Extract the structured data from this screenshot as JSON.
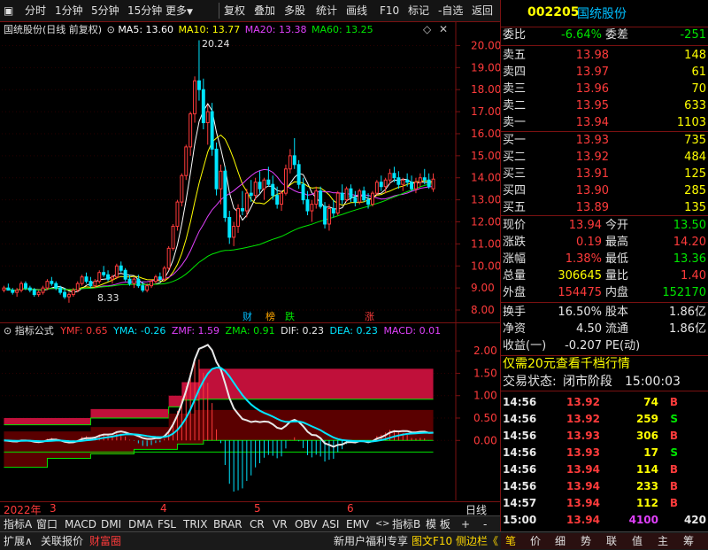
{
  "toolbar": {
    "timeframes": [
      "分时",
      "1分钟",
      "5分钟",
      "15分钟",
      "更多"
    ],
    "buttons": [
      "复权",
      "叠加",
      "多股",
      "统计",
      "画线",
      "F10",
      "标记",
      "-自选",
      "返回"
    ]
  },
  "stock": {
    "code": "002205",
    "name": "国统股份"
  },
  "chart_title": {
    "name": "国统股份(日线 前复权)",
    "ma": [
      {
        "label": "MA5: 13.60",
        "color": "#ffffff"
      },
      {
        "label": "MA10: 13.77",
        "color": "#ffff00"
      },
      {
        "label": "MA20: 13.38",
        "color": "#e040fb"
      },
      {
        "label": "MA60: 13.25",
        "color": "#00e600"
      }
    ]
  },
  "annotations": {
    "high": "20.24",
    "low": "8.33"
  },
  "event_marks": [
    {
      "label": "财",
      "color": "#00bfff"
    },
    {
      "label": "榜",
      "color": "#ffa500"
    },
    {
      "label": "跌",
      "color": "#00e600"
    },
    {
      "label": "涨",
      "color": "#ff3b3b"
    }
  ],
  "indicator": {
    "name": "指标公式",
    "values": [
      {
        "label": "YMF: 0.65",
        "color": "#ff3b3b"
      },
      {
        "label": "YMA: -0.26",
        "color": "#00e5ff"
      },
      {
        "label": "ZMF: 1.59",
        "color": "#e040fb"
      },
      {
        "label": "ZMA: 0.91",
        "color": "#00e600"
      },
      {
        "label": "DIF: 0.23",
        "color": "#e8e8e8"
      },
      {
        "label": "DEA: 0.23",
        "color": "#00e5ff"
      },
      {
        "label": "MACD: 0.01",
        "color": "#e040fb"
      }
    ]
  },
  "x_axis": {
    "year": "2022年",
    "months": [
      "3",
      "4",
      "5",
      "6"
    ],
    "period": "日线"
  },
  "bottom_tabs": [
    "指标A",
    "窗口",
    "MACD",
    "DMI",
    "DMA",
    "FSL",
    "TRIX",
    "BRAR",
    "CR",
    "VR",
    "OBV",
    "ASI",
    "EMV"
  ],
  "bottom_tabs_right": [
    "指标B",
    "模 板",
    "+",
    "-"
  ],
  "status_bar": {
    "left": [
      "扩展∧",
      "关联报价",
      "财富圈"
    ],
    "right": [
      "新用户福利专享",
      "图文F10",
      "侧边栏《"
    ],
    "right_icons": [
      "笔",
      "价",
      "细",
      "势",
      "联",
      "值",
      "主",
      "筹"
    ]
  },
  "quote": {
    "weibi_label": "委比",
    "weibi": "-6.64%",
    "weicha_label": "委差",
    "weicha": "-251",
    "asks": [
      {
        "label": "卖五",
        "price": "13.98",
        "vol": "148"
      },
      {
        "label": "卖四",
        "price": "13.97",
        "vol": "61"
      },
      {
        "label": "卖三",
        "price": "13.96",
        "vol": "70"
      },
      {
        "label": "卖二",
        "price": "13.95",
        "vol": "633"
      },
      {
        "label": "卖一",
        "price": "13.94",
        "vol": "1103"
      }
    ],
    "bids": [
      {
        "label": "买一",
        "price": "13.93",
        "vol": "735"
      },
      {
        "label": "买二",
        "price": "13.92",
        "vol": "484"
      },
      {
        "label": "买三",
        "price": "13.91",
        "vol": "125"
      },
      {
        "label": "买四",
        "price": "13.90",
        "vol": "285"
      },
      {
        "label": "买五",
        "price": "13.89",
        "vol": "135"
      }
    ],
    "stats": [
      {
        "l1": "现价",
        "v1": "13.94",
        "c1": "red",
        "l2": "今开",
        "v2": "13.50",
        "c2": "green"
      },
      {
        "l1": "涨跌",
        "v1": "0.19",
        "c1": "red",
        "l2": "最高",
        "v2": "14.20",
        "c2": "red"
      },
      {
        "l1": "涨幅",
        "v1": "1.38%",
        "c1": "red",
        "l2": "最低",
        "v2": "13.36",
        "c2": "green"
      },
      {
        "l1": "总量",
        "v1": "306645",
        "c1": "yellow",
        "l2": "量比",
        "v2": "1.40",
        "c2": "red"
      },
      {
        "l1": "外盘",
        "v1": "154475",
        "c1": "red",
        "l2": "内盘",
        "v2": "152170",
        "c2": "green"
      }
    ],
    "stats2": [
      {
        "l1": "换手",
        "v1": "16.50%",
        "l2": "股本",
        "v2": "1.86亿"
      },
      {
        "l1": "净资",
        "v1": "4.50",
        "l2": "流通",
        "v2": "1.86亿"
      },
      {
        "l1": "收益(一)",
        "v1": "-0.207",
        "l2": "PE(动)",
        "v2": ""
      }
    ],
    "promo": "仅需20元查看千档行情",
    "trade_status_label": "交易状态:",
    "trade_status": "闭市阶段",
    "trade_time": "15:00:03"
  },
  "ticks": [
    {
      "time": "14:56",
      "price": "13.92",
      "vol": "74",
      "bs": "B"
    },
    {
      "time": "14:56",
      "price": "13.92",
      "vol": "259",
      "bs": "S"
    },
    {
      "time": "14:56",
      "price": "13.93",
      "vol": "306",
      "bs": "B"
    },
    {
      "time": "14:56",
      "price": "13.93",
      "vol": "17",
      "bs": "S"
    },
    {
      "time": "14:56",
      "price": "13.94",
      "vol": "114",
      "bs": "B"
    },
    {
      "time": "14:56",
      "price": "13.94",
      "vol": "233",
      "bs": "B"
    },
    {
      "time": "14:57",
      "price": "13.94",
      "vol": "112",
      "bs": "B"
    },
    {
      "time": "15:00",
      "price": "13.94",
      "vol": "4100",
      "bs": "420"
    }
  ],
  "chart_data": [
    {
      "type": "candlestick",
      "title": "国统股份(日线 前复权)",
      "y_ticks": [
        "20.00",
        "19.00",
        "18.00",
        "17.00",
        "16.00",
        "15.00",
        "14.00",
        "13.00",
        "12.00",
        "11.00",
        "10.00",
        "9.00",
        "8.00"
      ],
      "ylim": [
        7.8,
        20.5
      ],
      "candles": [
        [
          8.9,
          9.1,
          8.8,
          9.0
        ],
        [
          9.0,
          9.2,
          8.9,
          8.9
        ],
        [
          8.9,
          9.0,
          8.7,
          8.8
        ],
        [
          8.8,
          9.0,
          8.6,
          8.9
        ],
        [
          8.9,
          9.3,
          8.8,
          9.2
        ],
        [
          9.2,
          9.3,
          8.9,
          9.0
        ],
        [
          9.0,
          9.1,
          8.8,
          8.9
        ],
        [
          8.9,
          9.0,
          8.6,
          8.7
        ],
        [
          8.7,
          8.9,
          8.6,
          8.8
        ],
        [
          8.8,
          9.1,
          8.7,
          9.0
        ],
        [
          9.0,
          9.4,
          8.9,
          9.3
        ],
        [
          9.3,
          9.5,
          9.1,
          9.2
        ],
        [
          9.2,
          9.3,
          8.9,
          9.0
        ],
        [
          9.0,
          9.1,
          8.7,
          8.8
        ],
        [
          8.8,
          9.0,
          8.5,
          8.6
        ],
        [
          8.6,
          8.8,
          8.33,
          8.7
        ],
        [
          8.7,
          9.0,
          8.6,
          8.9
        ],
        [
          8.9,
          9.3,
          8.8,
          9.2
        ],
        [
          9.2,
          9.6,
          9.1,
          9.5
        ],
        [
          9.5,
          9.7,
          9.2,
          9.3
        ],
        [
          9.3,
          9.5,
          9.0,
          9.1
        ],
        [
          9.1,
          9.4,
          9.0,
          9.3
        ],
        [
          9.3,
          9.8,
          9.2,
          9.7
        ],
        [
          9.7,
          10.0,
          9.5,
          9.6
        ],
        [
          9.6,
          9.8,
          9.3,
          9.4
        ],
        [
          9.4,
          9.6,
          9.2,
          9.5
        ],
        [
          9.5,
          10.1,
          9.4,
          10.0
        ],
        [
          10.0,
          10.2,
          9.7,
          9.8
        ],
        [
          9.8,
          9.9,
          9.3,
          9.4
        ],
        [
          9.4,
          9.6,
          9.1,
          9.2
        ],
        [
          9.2,
          9.5,
          9.0,
          9.4
        ],
        [
          9.4,
          9.6,
          9.0,
          9.1
        ],
        [
          9.1,
          9.3,
          8.8,
          8.9
        ],
        [
          8.9,
          9.2,
          8.8,
          9.1
        ],
        [
          9.1,
          9.4,
          9.0,
          9.3
        ],
        [
          9.3,
          9.6,
          9.2,
          9.5
        ],
        [
          9.5,
          9.7,
          9.3,
          9.4
        ],
        [
          9.4,
          10.0,
          9.3,
          9.9
        ],
        [
          9.9,
          10.9,
          9.8,
          10.8
        ],
        [
          10.8,
          11.9,
          10.7,
          11.8
        ],
        [
          11.8,
          13.0,
          11.6,
          12.9
        ],
        [
          12.9,
          14.2,
          12.7,
          14.1
        ],
        [
          14.1,
          15.5,
          13.9,
          15.4
        ],
        [
          15.4,
          17.0,
          15.0,
          16.9
        ],
        [
          16.9,
          18.6,
          16.5,
          18.4
        ],
        [
          18.4,
          20.24,
          17.5,
          18.0
        ],
        [
          18.0,
          18.5,
          16.2,
          16.5
        ],
        [
          16.5,
          17.3,
          15.5,
          17.0
        ],
        [
          17.0,
          17.4,
          15.0,
          15.3
        ],
        [
          15.3,
          15.6,
          13.2,
          13.5
        ],
        [
          13.5,
          14.6,
          12.8,
          14.3
        ],
        [
          14.3,
          14.5,
          12.0,
          12.2
        ],
        [
          12.2,
          12.5,
          11.0,
          11.3
        ],
        [
          11.3,
          12.0,
          10.9,
          11.8
        ],
        [
          11.8,
          12.8,
          11.5,
          12.6
        ],
        [
          12.6,
          13.4,
          12.3,
          12.5
        ],
        [
          12.5,
          13.5,
          12.2,
          13.3
        ],
        [
          13.3,
          13.9,
          12.9,
          13.2
        ],
        [
          13.2,
          14.0,
          13.0,
          13.8
        ],
        [
          13.8,
          14.3,
          13.3,
          13.5
        ],
        [
          13.5,
          14.0,
          13.0,
          13.9
        ],
        [
          13.9,
          14.5,
          13.6,
          13.7
        ],
        [
          13.7,
          14.1,
          13.0,
          13.2
        ],
        [
          13.2,
          13.6,
          12.6,
          12.8
        ],
        [
          12.8,
          13.4,
          12.5,
          13.3
        ],
        [
          13.3,
          14.6,
          13.2,
          14.4
        ],
        [
          14.4,
          15.3,
          14.2,
          15.0
        ],
        [
          15.0,
          15.8,
          14.4,
          14.6
        ],
        [
          14.6,
          14.8,
          13.5,
          13.7
        ],
        [
          13.7,
          14.0,
          12.8,
          13.0
        ],
        [
          13.0,
          13.4,
          12.3,
          12.5
        ],
        [
          12.5,
          13.0,
          12.0,
          12.8
        ],
        [
          12.8,
          13.6,
          12.6,
          13.4
        ],
        [
          13.4,
          13.6,
          12.6,
          12.7
        ],
        [
          12.7,
          12.9,
          11.7,
          11.9
        ],
        [
          11.9,
          12.8,
          11.6,
          12.6
        ],
        [
          12.6,
          13.0,
          12.2,
          12.4
        ],
        [
          12.4,
          13.4,
          12.3,
          13.3
        ],
        [
          13.3,
          13.7,
          12.8,
          13.0
        ],
        [
          13.0,
          13.6,
          12.9,
          13.5
        ],
        [
          13.5,
          13.7,
          12.9,
          13.1
        ],
        [
          13.1,
          13.4,
          12.7,
          12.9
        ],
        [
          12.9,
          13.5,
          12.8,
          13.4
        ],
        [
          13.4,
          13.6,
          12.9,
          13.0
        ],
        [
          13.0,
          13.3,
          12.6,
          12.8
        ],
        [
          12.8,
          13.4,
          12.7,
          13.3
        ],
        [
          13.3,
          13.9,
          13.2,
          13.8
        ],
        [
          13.8,
          14.1,
          13.4,
          13.6
        ],
        [
          13.6,
          14.0,
          13.3,
          13.9
        ],
        [
          13.9,
          14.4,
          13.7,
          14.2
        ],
        [
          14.2,
          14.5,
          13.8,
          14.0
        ],
        [
          14.0,
          14.3,
          13.5,
          13.7
        ],
        [
          13.7,
          14.0,
          13.4,
          13.9
        ],
        [
          13.9,
          14.2,
          13.6,
          13.8
        ],
        [
          13.8,
          14.1,
          13.4,
          13.5
        ],
        [
          13.5,
          14.0,
          13.3,
          13.8
        ],
        [
          13.8,
          14.2,
          13.6,
          14.0
        ],
        [
          14.0,
          14.4,
          13.7,
          13.9
        ],
        [
          13.9,
          14.2,
          13.5,
          13.6
        ],
        [
          13.5,
          14.2,
          13.36,
          13.94
        ]
      ]
    },
    {
      "type": "area",
      "title": "指标公式",
      "y_ticks": [
        "2.00",
        "1.50",
        "1.00",
        "0.50",
        "0.00"
      ],
      "ylim": [
        -1.3,
        2.3
      ]
    }
  ]
}
